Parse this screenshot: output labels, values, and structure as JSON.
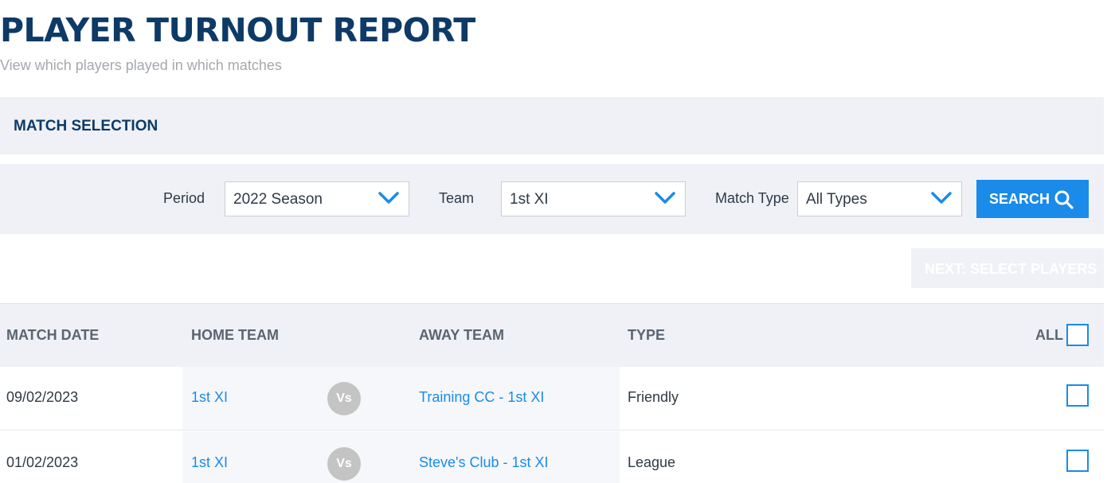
{
  "page": {
    "title": "PLAYER TURNOUT REPORT",
    "subtitle": "View which players played in which matches"
  },
  "match_selection": {
    "title": "MATCH SELECTION"
  },
  "filters": {
    "period": {
      "label": "Period",
      "value": "2022 Season"
    },
    "team": {
      "label": "Team",
      "value": "1st XI"
    },
    "match_type": {
      "label": "Match Type",
      "value": "All Types"
    },
    "search_label": "SEARCH",
    "search_icon": "search-icon",
    "dropdown_icon": "chevron-down-icon"
  },
  "next_button": {
    "label": "NEXT: SELECT PLAYERS",
    "enabled": false
  },
  "table": {
    "headers": {
      "match_date": "MATCH DATE",
      "home_team": "HOME TEAM",
      "away_team": "AWAY TEAM",
      "type": "TYPE",
      "all": "ALL"
    },
    "rows": [
      {
        "date": "09/02/2023",
        "home": "1st XI",
        "vs": "Vs",
        "away": "Training CC - 1st XI",
        "type": "Friendly",
        "selected": false
      },
      {
        "date": "01/02/2023",
        "home": "1st XI",
        "vs": "Vs",
        "away": "Steve's Club - 1st XI",
        "type": "League",
        "selected": false
      }
    ]
  },
  "colors": {
    "accent": "#1a8be8",
    "title": "#0d3a66",
    "panel": "#eff1f6"
  }
}
